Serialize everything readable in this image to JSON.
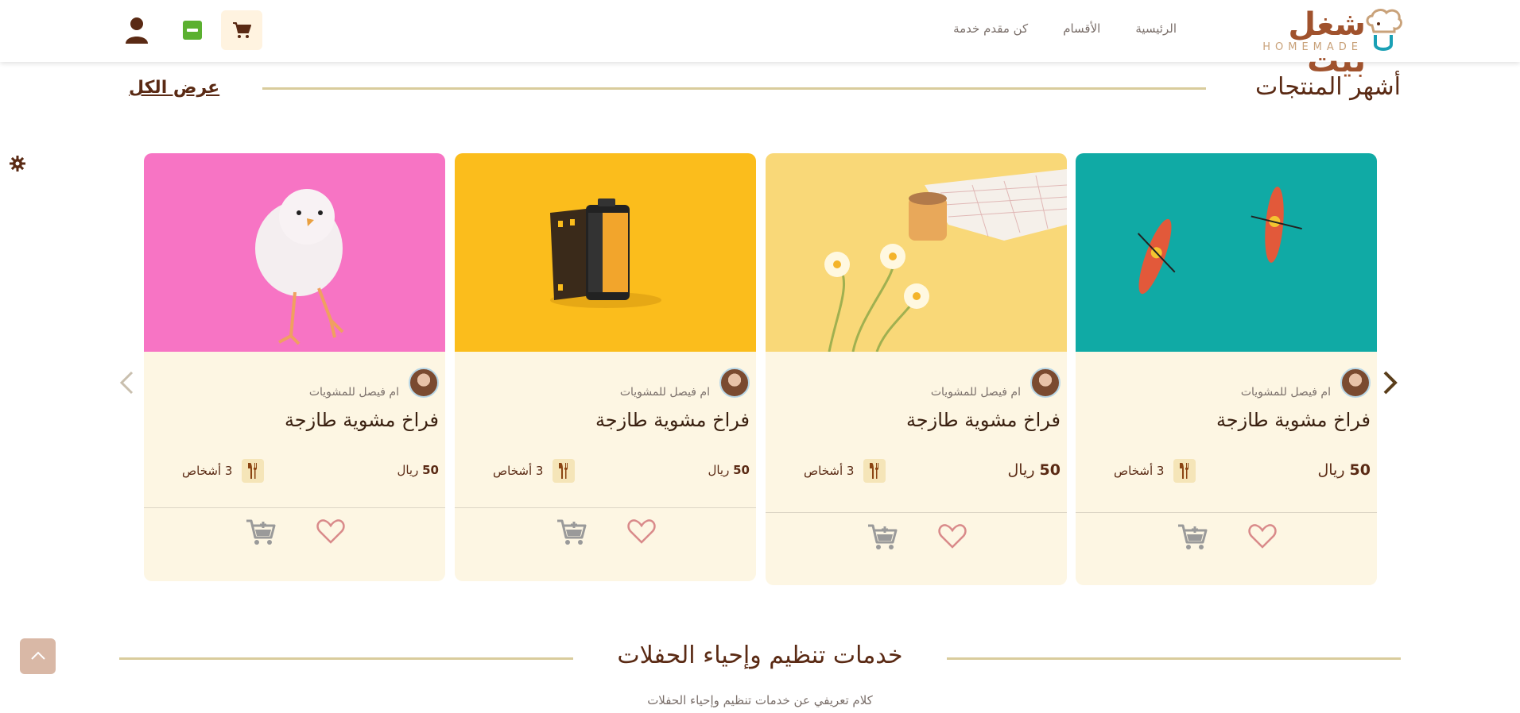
{
  "header": {
    "logo_ar": "شغل بيت",
    "logo_en": "HOMEMADE",
    "nav": [
      "الرئيسية",
      "الأقسام",
      "كن مقدم خدمة"
    ]
  },
  "popular": {
    "title": "أشهر المنتجات",
    "view_all": "عرض الكل",
    "cards": [
      {
        "seller": "ام فيصل للمشويات",
        "title": "فراخ مشوية طازجة",
        "price": "50",
        "currency": "ريال",
        "persons": "3 أشخاص",
        "image_bg": "#10aaa5"
      },
      {
        "seller": "ام فيصل للمشويات",
        "title": "فراخ مشوية طازجة",
        "price": "50",
        "currency": "ريال",
        "persons": "3 أشخاص",
        "image_bg": "#f9d878"
      },
      {
        "seller": "ام فيصل للمشويات",
        "title": "فراخ مشوية طازجة",
        "price": "50",
        "currency": "ريال",
        "persons": "3 أشخاص",
        "image_bg": "#fbbd1c"
      },
      {
        "seller": "ام فيصل للمشويات",
        "title": "فراخ مشوية طازجة",
        "price": "50",
        "currency": "ريال",
        "persons": "3 أشخاص",
        "image_bg": "#f774c4"
      }
    ]
  },
  "events": {
    "title": "خدمات تنظيم وإحياء الحفلات",
    "subtitle": "كلام تعريفي عن خدمات تنظيم وإحياء الحفلات"
  },
  "colors": {
    "brand": "#5a2a14",
    "card_bg": "#fdf6e3",
    "accent_line": "#d9cc9c",
    "heart": "#d98a8a"
  }
}
